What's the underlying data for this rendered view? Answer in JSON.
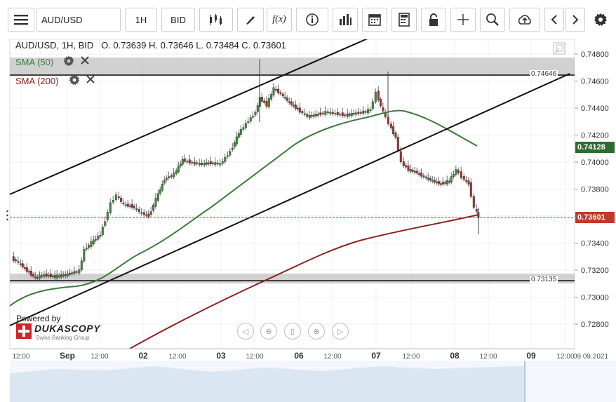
{
  "toolbar": {
    "symbol": "AUD/USD",
    "timeframe": "1H",
    "side": "BID",
    "icons": [
      "menu-icon",
      "candles-icon",
      "draw-icon",
      "function-icon",
      "info-icon",
      "indicators-icon",
      "calendar-icon",
      "calculator-icon",
      "lock-icon",
      "crosshair-icon",
      "zoom-icon",
      "cloud-upload-icon",
      "prev-icon",
      "next-icon",
      "gear-icon"
    ]
  },
  "chart_header": {
    "title": "AUD/USD, 1H, BID",
    "ohlc": "O. 0.73639 H. 0.73646 L. 0.73484 C. 0.73601"
  },
  "indicators": [
    {
      "label": "SMA (50)",
      "color": "#3d7a3d"
    },
    {
      "label": "SMA (200)",
      "color": "#8b2020"
    }
  ],
  "levels": {
    "upper": "0.74646",
    "lower": "0.73135"
  },
  "price_tags": {
    "sma_value": "0.74128",
    "last_price": "0.73601",
    "sma_color": "#2f6b2f",
    "last_color": "#c0392b"
  },
  "y_axis": [
    "0.74800",
    "0.74600",
    "0.74400",
    "0.74200",
    "0.74000",
    "0.73800",
    "0.73600",
    "0.73400",
    "0.73200",
    "0.73000",
    "0.72800"
  ],
  "x_axis": [
    {
      "label": "12:00",
      "bold": false
    },
    {
      "label": "Sep",
      "bold": true
    },
    {
      "label": "12:00",
      "bold": false
    },
    {
      "label": "02",
      "bold": true
    },
    {
      "label": "12:00",
      "bold": false
    },
    {
      "label": "03",
      "bold": true
    },
    {
      "label": "12:00",
      "bold": false
    },
    {
      "label": "06",
      "bold": true
    },
    {
      "label": "12:00",
      "bold": false
    },
    {
      "label": "07",
      "bold": true
    },
    {
      "label": "12:00",
      "bold": false
    },
    {
      "label": "08",
      "bold": true
    },
    {
      "label": "12:00",
      "bold": false
    },
    {
      "label": "09",
      "bold": true
    },
    {
      "label": "12:00",
      "bold": false
    },
    {
      "label": "09.09.2021",
      "bold": false
    }
  ],
  "branding": {
    "powered": "Powered by",
    "name": "DUKASCOPY",
    "sub": "Swiss Banking Group"
  },
  "colors": {
    "up": "#3d8a3d",
    "down": "#a33232",
    "sma50": "#3d7a3d",
    "sma200": "#8b2020",
    "band": "#cfcfcf"
  }
}
